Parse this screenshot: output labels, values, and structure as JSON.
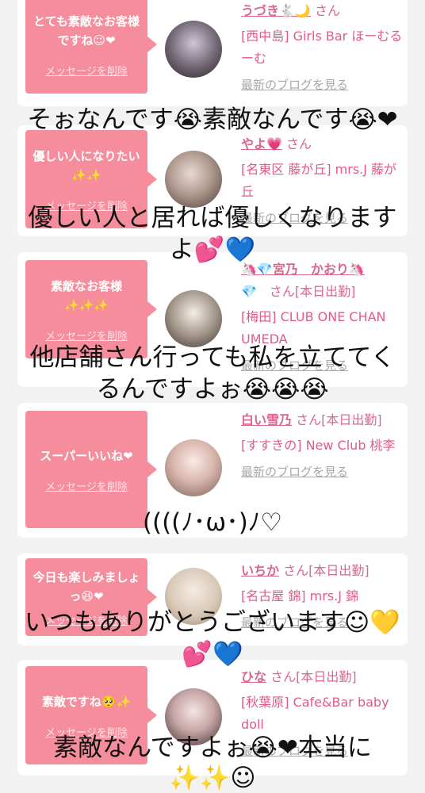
{
  "delete_label": "メッセージを削除",
  "blog_label": "最新のブログを見る",
  "cards": [
    {
      "message": "とても素敵なお客様ですね☺❤",
      "name": "うづき🐇🌙",
      "status": "さん",
      "shop": "[西中島] Girls Bar ほーむるーむ"
    },
    {
      "message": "優しい人になりたい✨✨",
      "name": "やよ💗",
      "status": "さん",
      "shop": "[名東区 藤が丘] mrs.J 藤が丘"
    },
    {
      "message": "素敵なお客様✨✨✨",
      "name": "🦄💎宮乃　かおり🦄",
      "status": "💎　さん[本日出勤]",
      "shop": "[梅田] CLUB ONE CHAN UMEDA"
    },
    {
      "message": "スーパーいいね❤",
      "name": "白い雪乃",
      "status": "さん[本日出勤]",
      "shop": "[すすきの] New Club 桃李"
    },
    {
      "message": "今日も楽しみましょっ😆❤",
      "name": "いちか",
      "status": "さん[本日出勤]",
      "shop": "[名古屋 錦] mrs.J 錦"
    },
    {
      "message": "素敵ですね🥺✨",
      "name": "ひな",
      "status": "さん[本日出勤]",
      "shop": "[秋葉原] Cafe&Bar baby doll"
    }
  ],
  "overlays": [
    "そぉなんです😭素敵なんです😭❤",
    "優しい人と居れば優しくなります",
    "よ💕💙",
    "他店舗さん行っても私を立ててく",
    "るんですよぉ😭😭😭",
    "((((ﾉ･ω･)ﾉ♡",
    "いつもありがとうございます☺💛",
    "💕💙",
    "素敵なんですよぉ😭❤本当に",
    "✨✨☺"
  ]
}
